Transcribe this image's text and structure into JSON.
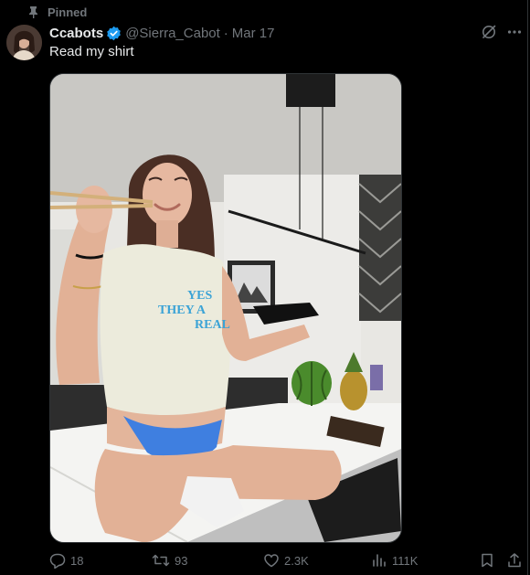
{
  "pinned": {
    "label": "Pinned",
    "icon": "pin-icon"
  },
  "author": {
    "display_name": "Ccabots",
    "verified": true,
    "handle": "@Sierra_Cabot",
    "separator": "·",
    "date": "Mar 17"
  },
  "post": {
    "text": "Read my shirt",
    "shirt_text": [
      "YES",
      "THEY A",
      "REAL"
    ]
  },
  "actions": {
    "replies": "18",
    "reposts": "93",
    "likes": "2.3K",
    "views": "111K"
  },
  "colors": {
    "background": "#000000",
    "text": "#e7e9ea",
    "muted": "#71767b",
    "verified": "#1d9bf0",
    "border": "#2f3336"
  }
}
